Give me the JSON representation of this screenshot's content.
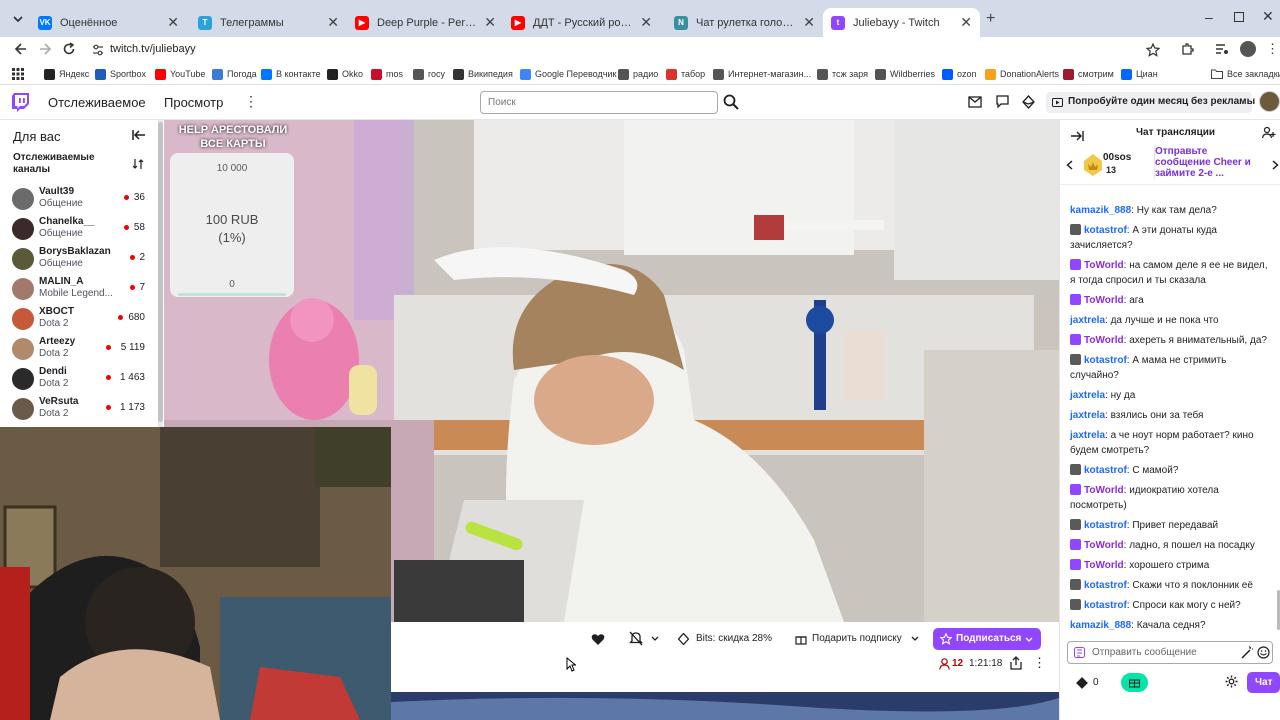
{
  "browser": {
    "tabs": [
      {
        "title": "Оценённое",
        "icon": "vk-icon",
        "color": "#0077ff",
        "glyph": "VK"
      },
      {
        "title": "Телеграммы",
        "icon": "telegram-icon",
        "color": "#2aa3dc",
        "glyph": "T"
      },
      {
        "title": "Deep Purple - Perfect Strangers",
        "icon": "youtube-icon",
        "color": "#ff0000",
        "glyph": "▶"
      },
      {
        "title": "ДДТ - Русский рок (Аудио) - YouTube",
        "icon": "youtube-icon",
        "color": "#ff0000",
        "glyph": "▶"
      },
      {
        "title": "Чат рулетка голосовая — Nekto.me",
        "icon": "chat-icon",
        "color": "#3a8f9e",
        "glyph": "N"
      },
      {
        "title": "Juliebayy - Twitch",
        "icon": "twitch-icon",
        "color": "#9146ff",
        "glyph": "t",
        "active": true
      }
    ],
    "url": "twitch.tv/juliebayy",
    "bookmarks": [
      {
        "label": "Яндекс",
        "color": "#222"
      },
      {
        "label": "Sportbox",
        "color": "#1d5fb8"
      },
      {
        "label": "YouTube",
        "color": "#ff0000"
      },
      {
        "label": "Погода",
        "color": "#3a7bd5"
      },
      {
        "label": "В контакте",
        "color": "#0077ff"
      },
      {
        "label": "Okko",
        "color": "#222"
      },
      {
        "label": "mos",
        "color": "#c8102e"
      },
      {
        "label": "rocy",
        "color": "#555"
      },
      {
        "label": "Википедия",
        "color": "#333"
      },
      {
        "label": "Google Переводчик",
        "color": "#4285f4"
      },
      {
        "label": "радио",
        "color": "#555"
      },
      {
        "label": "табор",
        "color": "#d9332f"
      },
      {
        "label": "Интернет-магазин...",
        "color": "#555"
      },
      {
        "label": "тсж заря",
        "color": "#555"
      },
      {
        "label": "Wildberries",
        "color": "#555"
      },
      {
        "label": "ozon",
        "color": "#005bff"
      },
      {
        "label": "DonationAlerts",
        "color": "#f7a21b"
      },
      {
        "label": "смотрим",
        "color": "#9b1b30"
      },
      {
        "label": "Циан",
        "color": "#0468ff"
      }
    ],
    "all_bookmarks": "Все закладки"
  },
  "twitch": {
    "nav_following": "Отслеживаемое",
    "nav_browse": "Просмотр",
    "search_placeholder": "Поиск",
    "promo": "Попробуйте один месяц без рекламы",
    "accent": "#9146ff"
  },
  "sidebar": {
    "title": "Для вас",
    "section": "Отслеживаемые каналы",
    "channels": [
      {
        "name": "Vault39",
        "game": "Общение",
        "viewers": "36",
        "color": "#6b6b6b"
      },
      {
        "name": "Chanelka__",
        "game": "Общение",
        "viewers": "58",
        "color": "#3a2a2a"
      },
      {
        "name": "BorysBaklazan",
        "game": "Общение",
        "viewers": "2",
        "color": "#5a5a3a"
      },
      {
        "name": "MALIN_A",
        "game": "Mobile Legend...",
        "viewers": "7",
        "color": "#a07a6a"
      },
      {
        "name": "XBOCT",
        "game": "Dota 2",
        "viewers": "680",
        "color": "#c45a3a"
      },
      {
        "name": "Arteezy",
        "game": "Dota 2",
        "viewers": "5 119",
        "color": "#b08a6a"
      },
      {
        "name": "Dendi",
        "game": "Dota 2",
        "viewers": "1 463",
        "color": "#2a2a2a"
      },
      {
        "name": "VeRsuta",
        "game": "Dota 2",
        "viewers": "1 173",
        "color": "#6a5a4a"
      }
    ]
  },
  "overlay": {
    "title": "HELP АРЕСТОВАЛИ ВСЕ КАРТЫ",
    "goal": "10 000",
    "amount": "100 RUB",
    "percent": "(1%)",
    "base": "0"
  },
  "player": {
    "bits_label": "Bits: скидка 28%",
    "gift_label": "Подарить подписку",
    "subscribe_label": "Подписаться",
    "viewers": "12",
    "uptime": "1:21:18"
  },
  "chat": {
    "title": "Чат трансляции",
    "hype_user": "00sos",
    "hype_count": "13",
    "hype_text": "Отправьте сообщение Cheer и займите 2-е ...",
    "input_placeholder": "Отправить сообщение",
    "points": "0",
    "send_label": "Чат",
    "messages": [
      {
        "user": "kamazik_888",
        "text": "Ну как там дела?",
        "color": "#1e69ff",
        "badge": ""
      },
      {
        "user": "kotastrof",
        "text": "А эти донаты куда зачисляется?",
        "color": "#1e69ff",
        "badge": "#5a5a5a"
      },
      {
        "user": "ToWorld",
        "text": "на самом деле я ее не видел, я тогда спросил и ты сказала",
        "color": "#8a2be2",
        "badge": "#9146ff"
      },
      {
        "user": "ToWorld",
        "text": "ага",
        "color": "#8a2be2",
        "badge": "#9146ff"
      },
      {
        "user": "jaxtrela",
        "text": "да лучше и не пока что",
        "color": "#1e69ff",
        "badge": ""
      },
      {
        "user": "ToWorld",
        "text": "ахереть я внимательный, да?",
        "color": "#8a2be2",
        "badge": "#9146ff"
      },
      {
        "user": "kotastrof",
        "text": "А мама не стримить случайно?",
        "color": "#1e69ff",
        "badge": "#5a5a5a"
      },
      {
        "user": "jaxtrela",
        "text": "ну да",
        "color": "#1e69ff",
        "badge": ""
      },
      {
        "user": "jaxtrela",
        "text": "взялись они за тебя",
        "color": "#1e69ff",
        "badge": ""
      },
      {
        "user": "jaxtrela",
        "text": "а че ноут норм работает? кино будем смотреть?",
        "color": "#1e69ff",
        "badge": ""
      },
      {
        "user": "kotastrof",
        "text": "С мамой?",
        "color": "#1e69ff",
        "badge": "#5a5a5a"
      },
      {
        "user": "ToWorld",
        "text": "идиократию хотела посмотреть)",
        "color": "#8a2be2",
        "badge": "#9146ff"
      },
      {
        "user": "kotastrof",
        "text": "Привет передавай",
        "color": "#1e69ff",
        "badge": "#5a5a5a"
      },
      {
        "user": "ToWorld",
        "text": "ладно, я пошел на посадку",
        "color": "#8a2be2",
        "badge": "#9146ff"
      },
      {
        "user": "ToWorld",
        "text": "хорошего стрима",
        "color": "#8a2be2",
        "badge": "#9146ff"
      },
      {
        "user": "kotastrof",
        "text": "Скажи что я поклонник её",
        "color": "#1e69ff",
        "badge": "#5a5a5a"
      },
      {
        "user": "kotastrof",
        "text": "Спроси как могу с ней?",
        "color": "#1e69ff",
        "badge": "#5a5a5a"
      },
      {
        "user": "kamazik_888",
        "text": "Качала седня?",
        "color": "#1e69ff",
        "badge": ""
      }
    ]
  }
}
